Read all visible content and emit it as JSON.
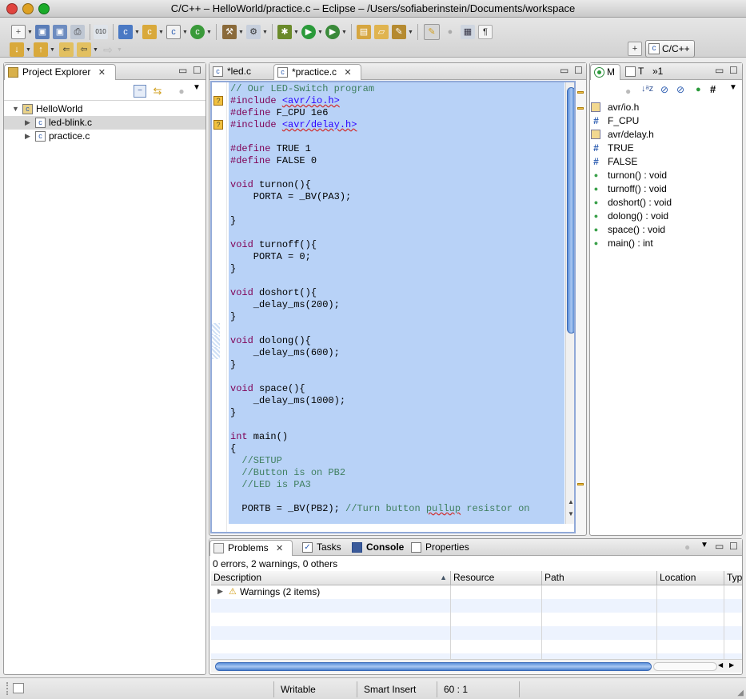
{
  "window": {
    "title": "C/C++ – HelloWorld/practice.c – Eclipse – /Users/sofiaberinstein/Documents/workspace",
    "traffic_light_colors": [
      "#e0443e",
      "#dea123",
      "#1aab29"
    ]
  },
  "perspective": {
    "label": "C/C++",
    "icon": "open-perspective-icon"
  },
  "project_explorer": {
    "title": "Project Explorer",
    "tree": [
      {
        "label": "HelloWorld",
        "icon": "c-project-icon",
        "expanded": true,
        "depth": 0
      },
      {
        "label": "led-blink.c",
        "icon": "c-file-icon",
        "expanded": false,
        "depth": 1,
        "selected": true
      },
      {
        "label": "practice.c",
        "icon": "c-file-icon",
        "expanded": false,
        "depth": 1,
        "selected": false
      }
    ]
  },
  "editor": {
    "tabs": [
      {
        "label": "*led.c",
        "active": false
      },
      {
        "label": "*practice.c",
        "active": true
      }
    ],
    "lines": [
      "// Our LED-Switch program",
      "#include <avr/io.h>",
      "#define F_CPU 1e6",
      "#include <avr/delay.h>",
      "",
      "#define TRUE 1",
      "#define FALSE 0",
      "",
      "void turnon(){",
      "    PORTA = _BV(PA3);",
      "",
      "}",
      "",
      "void turnoff(){",
      "    PORTA = 0;",
      "}",
      "",
      "void doshort(){",
      "    _delay_ms(200);",
      "}",
      "",
      "void dolong(){",
      "    _delay_ms(600);",
      "}",
      "",
      "void space(){",
      "    _delay_ms(1000);",
      "}",
      "",
      "int main()",
      "{",
      "  //SETUP",
      "  //Button is on PB2",
      "  //LED is PA3",
      "",
      "  PORTB = _BV(PB2); //Turn button pullup resistor on"
    ],
    "warning_lines": [
      2,
      4
    ]
  },
  "outline": {
    "tabs": [
      {
        "label": "M",
        "icon": "outline-icon"
      },
      {
        "label": "T",
        "icon": "task-list-icon"
      },
      {
        "label": "»1",
        "icon": "chevron-more-icon"
      }
    ],
    "items": [
      {
        "label": "avr/io.h",
        "icon": "include-icon"
      },
      {
        "label": "F_CPU",
        "icon": "macro-icon"
      },
      {
        "label": "avr/delay.h",
        "icon": "include-icon"
      },
      {
        "label": "TRUE",
        "icon": "macro-icon"
      },
      {
        "label": "FALSE",
        "icon": "macro-icon"
      },
      {
        "label": "turnon() : void",
        "icon": "function-icon"
      },
      {
        "label": "turnoff() : void",
        "icon": "function-icon"
      },
      {
        "label": "doshort() : void",
        "icon": "function-icon"
      },
      {
        "label": "dolong() : void",
        "icon": "function-icon"
      },
      {
        "label": "space() : void",
        "icon": "function-icon"
      },
      {
        "label": "main() : int",
        "icon": "function-icon"
      }
    ]
  },
  "bottom": {
    "tabs": [
      {
        "label": "Problems",
        "icon": "problems-icon",
        "active": true
      },
      {
        "label": "Tasks",
        "icon": "tasks-icon",
        "active": false
      },
      {
        "label": "Console",
        "icon": "console-icon",
        "active": false
      },
      {
        "label": "Properties",
        "icon": "properties-icon",
        "active": false
      }
    ],
    "summary": "0 errors, 2 warnings, 0 others",
    "columns": [
      "Description",
      "Resource",
      "Path",
      "Location",
      "Typ"
    ],
    "rows": [
      {
        "description": "Warnings (2 items)",
        "icon": "warning-icon"
      }
    ]
  },
  "status": {
    "writable": "Writable",
    "insert_mode": "Smart Insert",
    "position": "60 : 1"
  }
}
